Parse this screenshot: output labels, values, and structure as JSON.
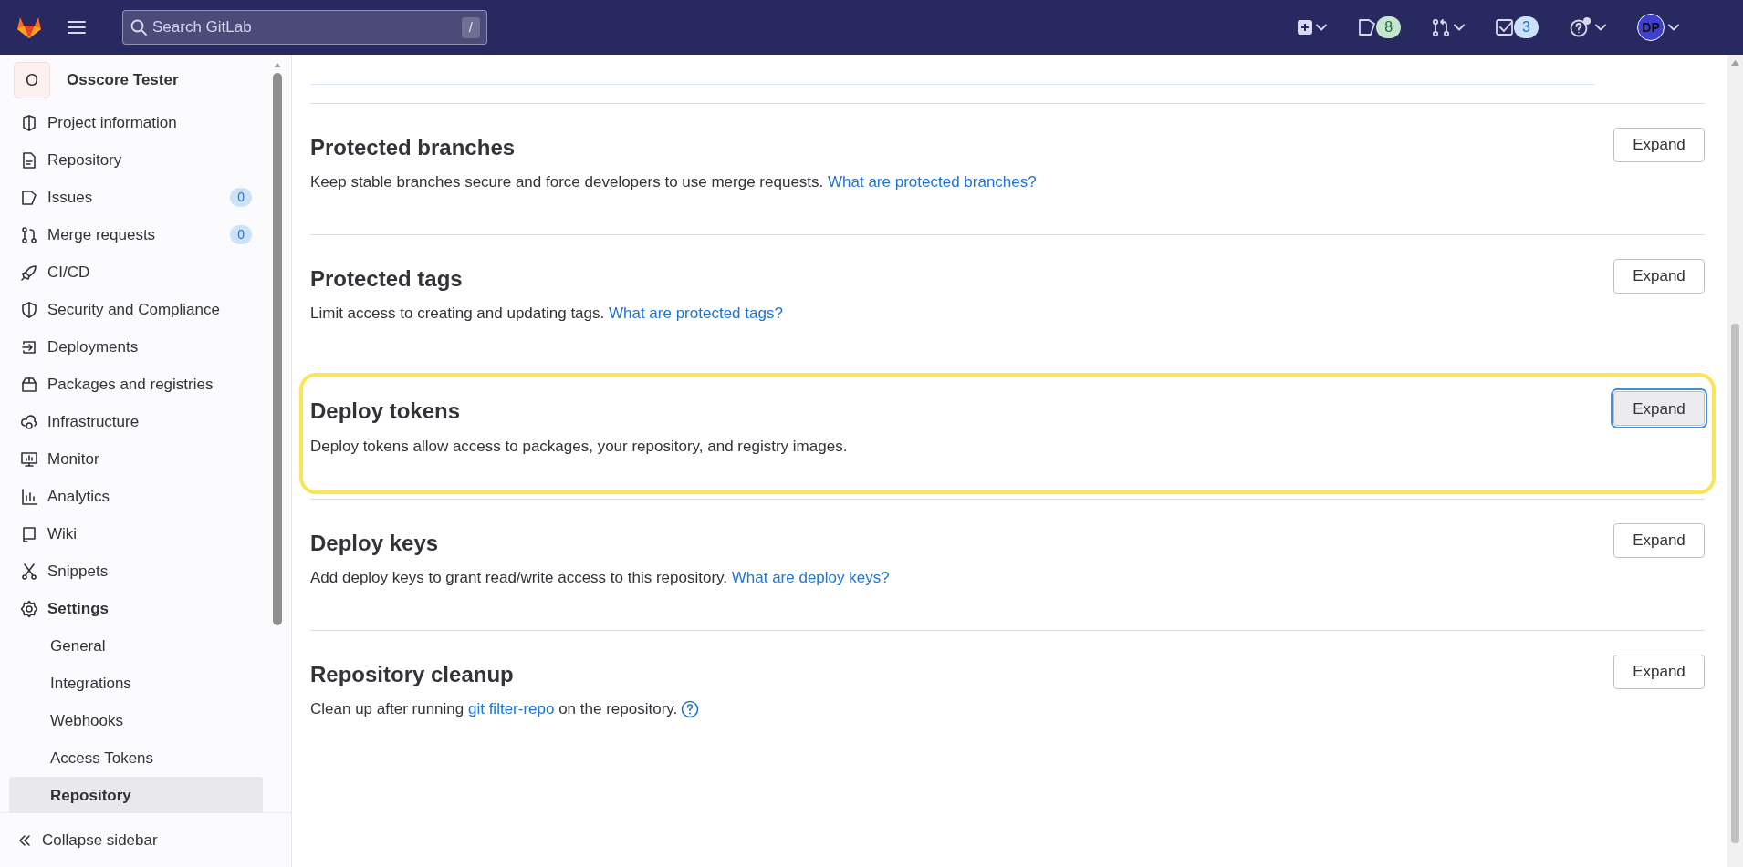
{
  "top_bar": {
    "search": {
      "placeholder": "Search GitLab",
      "shortcut": "/"
    },
    "issues_count": "8",
    "todos_count": "3",
    "avatar_initials": "DP"
  },
  "sidebar": {
    "project": {
      "letter": "O",
      "name": "Osscore Tester"
    },
    "items": [
      {
        "label": "Project information",
        "selected": false
      },
      {
        "label": "Repository",
        "selected": false
      },
      {
        "label": "Issues",
        "count": "0",
        "selected": false
      },
      {
        "label": "Merge requests",
        "count": "0",
        "selected": false
      },
      {
        "label": "CI/CD",
        "selected": false
      },
      {
        "label": "Security and Compliance",
        "selected": false
      },
      {
        "label": "Deployments",
        "selected": false
      },
      {
        "label": "Packages and registries",
        "selected": false
      },
      {
        "label": "Infrastructure",
        "selected": false
      },
      {
        "label": "Monitor",
        "selected": false
      },
      {
        "label": "Analytics",
        "selected": false
      },
      {
        "label": "Wiki",
        "selected": false
      },
      {
        "label": "Snippets",
        "selected": false
      },
      {
        "label": "Settings",
        "selected": false,
        "expanded": true,
        "children": [
          {
            "label": "General",
            "selected": false
          },
          {
            "label": "Integrations",
            "selected": false
          },
          {
            "label": "Webhooks",
            "selected": false
          },
          {
            "label": "Access Tokens",
            "selected": false
          },
          {
            "label": "Repository",
            "selected": true
          }
        ]
      }
    ],
    "collapse": "Collapse sidebar"
  },
  "sections": [
    {
      "heading": "Protected branches",
      "description": [
        {
          "text": "Keep stable branches secure and force developers to use merge requests. "
        },
        {
          "link": "What are protected branches?"
        }
      ],
      "button": "Expand",
      "highlighted": false,
      "focused": false
    },
    {
      "heading": "Protected tags",
      "description": [
        {
          "text": "Limit access to creating and updating tags. "
        },
        {
          "link": "What are protected tags?"
        }
      ],
      "button": "Expand",
      "highlighted": false,
      "focused": false
    },
    {
      "heading": "Deploy tokens",
      "description": [
        {
          "text": "Deploy tokens allow access to packages, your repository, and registry images."
        }
      ],
      "button": "Expand",
      "highlighted": true,
      "focused": true
    },
    {
      "heading": "Deploy keys",
      "description": [
        {
          "text": "Add deploy keys to grant read/write access to this repository. "
        },
        {
          "link": "What are deploy keys?"
        }
      ],
      "button": "Expand",
      "highlighted": false,
      "focused": false
    },
    {
      "heading": "Repository cleanup",
      "description": [
        {
          "text": "Clean up after running "
        },
        {
          "link": "git filter-repo"
        },
        {
          "text": " on the repository. "
        }
      ],
      "help": true,
      "button": "Expand",
      "highlighted": false,
      "focused": false
    }
  ]
}
